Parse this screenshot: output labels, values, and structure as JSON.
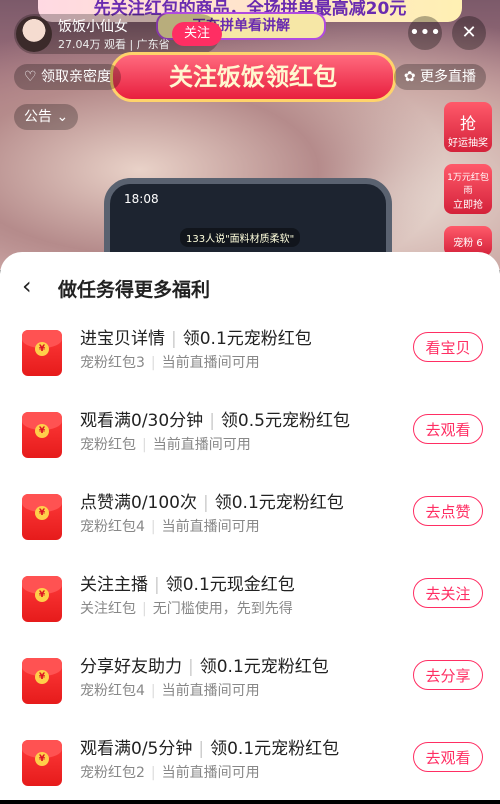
{
  "live": {
    "banner_text": "先关注红包的商品，全场拼单最高减20元",
    "banner_sub": "正在拼单看讲解",
    "host_name": "饭饭小仙女",
    "host_meta": "27.04万 观看 | 广东省",
    "follow_label": "关注",
    "promo_text": "关注饭饭领红包",
    "pill_intimacy": "领取亲密度",
    "pill_more_live": "更多直播",
    "pill_notice": "公告",
    "side_lucky": "好运抽奖",
    "side_grab_top": "1万元红包雨",
    "side_grab": "立即抢",
    "side_pet_top": "宠粉",
    "side_pet_count": "6",
    "phone_time": "18:08",
    "phone_notice": "133人说\"面料材质柔软\"",
    "icons": {
      "more": "more-dots-icon",
      "close": "close-icon",
      "back": "back-chevron-icon"
    }
  },
  "sheet": {
    "title": "做任务得更多福利",
    "tasks": [
      {
        "task": "进宝贝详情",
        "reward": "领0.1元宠粉红包",
        "category": "宠粉红包3",
        "note": "当前直播间可用",
        "action": "看宝贝"
      },
      {
        "task": "观看满0/30分钟",
        "reward": "领0.5元宠粉红包",
        "category": "宠粉红包",
        "note": "当前直播间可用",
        "action": "去观看"
      },
      {
        "task": "点赞满0/100次",
        "reward": "领0.1元宠粉红包",
        "category": "宠粉红包4",
        "note": "当前直播间可用",
        "action": "去点赞"
      },
      {
        "task": "关注主播",
        "reward": "领0.1元现金红包",
        "category": "关注红包",
        "note": "无门槛使用，先到先得",
        "action": "去关注"
      },
      {
        "task": "分享好友助力",
        "reward": "领0.1元宠粉红包",
        "category": "宠粉红包4",
        "note": "当前直播间可用",
        "action": "去分享"
      },
      {
        "task": "观看满0/5分钟",
        "reward": "领0.1元宠粉红包",
        "category": "宠粉红包2",
        "note": "当前直播间可用",
        "action": "去观看"
      }
    ]
  },
  "colors": {
    "accent": "#ff2e63",
    "envelope": "#e61b1b"
  }
}
